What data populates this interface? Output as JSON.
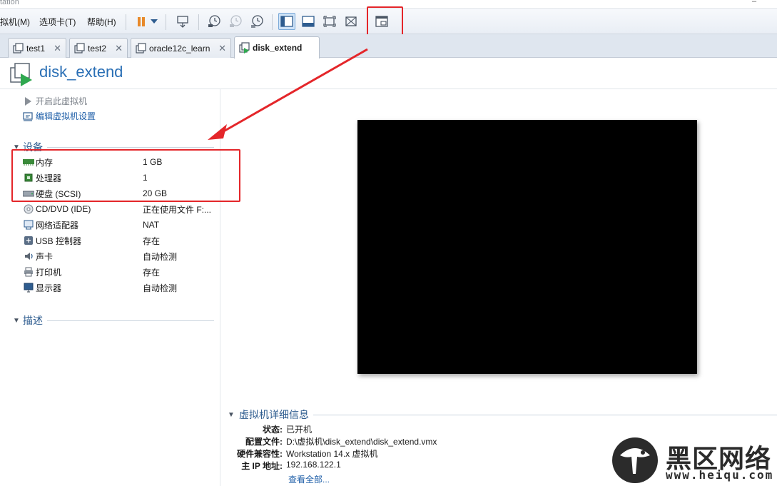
{
  "app": {
    "title": "tation"
  },
  "menu": {
    "vm": "拟机(M)",
    "tabs": "选项卡(T)",
    "help": "帮助(H)"
  },
  "tabs": [
    {
      "label": "test1"
    },
    {
      "label": "test2"
    },
    {
      "label": "oracle12c_learn"
    },
    {
      "label": "disk_extend"
    }
  ],
  "vm": {
    "name": "disk_extend"
  },
  "actions": {
    "power_on": "开启此虚拟机",
    "edit_settings": "编辑虚拟机设置"
  },
  "devices": {
    "title": "设备",
    "items": [
      {
        "name": "内存",
        "value": "1 GB",
        "icon": "memory-icon"
      },
      {
        "name": "处理器",
        "value": "1",
        "icon": "cpu-icon"
      },
      {
        "name": "硬盘 (SCSI)",
        "value": "20 GB",
        "icon": "hard-disk-icon"
      },
      {
        "name": "CD/DVD (IDE)",
        "value": "正在使用文件 F:...",
        "icon": "cd-dvd-icon"
      },
      {
        "name": "网络适配器",
        "value": "NAT",
        "icon": "network-adapter-icon"
      },
      {
        "name": "USB 控制器",
        "value": "存在",
        "icon": "usb-icon"
      },
      {
        "name": "声卡",
        "value": "自动检测",
        "icon": "sound-card-icon"
      },
      {
        "name": "打印机",
        "value": "存在",
        "icon": "printer-icon"
      },
      {
        "name": "显示器",
        "value": "自动检测",
        "icon": "display-icon"
      }
    ]
  },
  "description": {
    "title": "描述"
  },
  "details": {
    "title": "虚拟机详细信息",
    "rows": [
      {
        "key": "状态:",
        "value": "已开机"
      },
      {
        "key": "配置文件:",
        "value": "D:\\虚拟机\\disk_extend\\disk_extend.vmx"
      },
      {
        "key": "硬件兼容性:",
        "value": "Workstation 14.x 虚拟机"
      },
      {
        "key": "主 IP 地址:",
        "value": "192.168.122.1"
      }
    ],
    "view_all": "查看全部..."
  },
  "watermark": {
    "text": "黑区网络",
    "url": "www.heiqu.com"
  },
  "colors": {
    "accent": "#2a6fb5",
    "highlight": "#e4262a",
    "console": "#000000",
    "pause": "#e8892a"
  }
}
